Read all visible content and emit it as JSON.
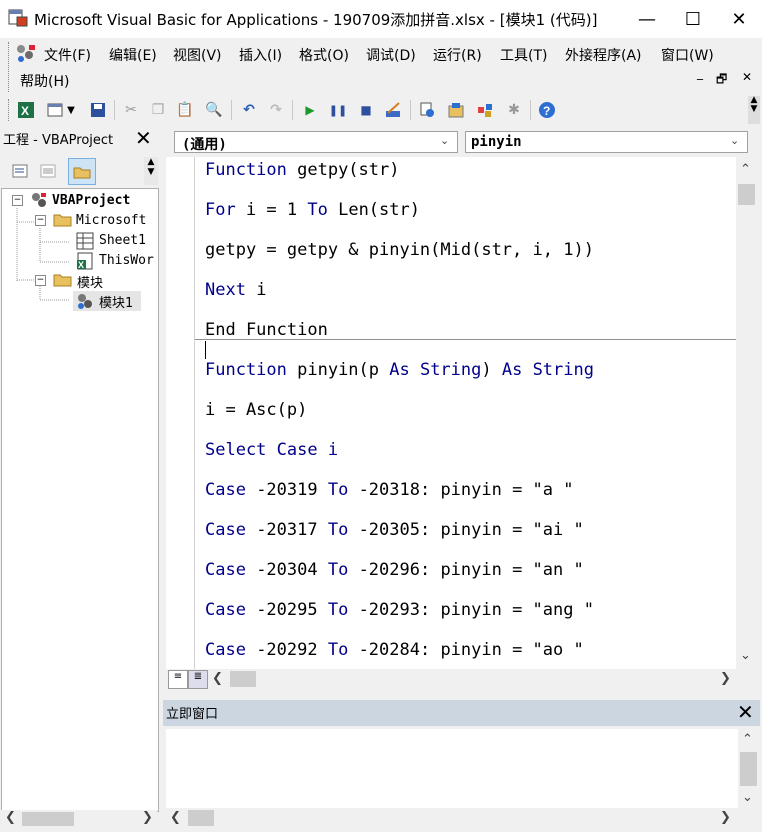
{
  "window": {
    "title": "Microsoft Visual Basic for Applications - 190709添加拼音.xlsx - [模块1 (代码)]",
    "minimize": "—",
    "maximize": "☐",
    "close": "✕"
  },
  "menu": {
    "items": [
      "文件(F)",
      "编辑(E)",
      "视图(V)",
      "插入(I)",
      "格式(O)",
      "调试(D)",
      "运行(R)",
      "工具(T)",
      "外接程序(A)",
      "窗口(W)",
      "帮助(H)"
    ],
    "mdi_min": "_",
    "mdi_restore": "🗗",
    "mdi_close": "✕"
  },
  "toolbar": {
    "icons": [
      "excel-icon",
      "insert-module-icon",
      "save-icon",
      "cut-icon",
      "copy-icon",
      "paste-icon",
      "find-icon",
      "undo-icon",
      "redo-icon",
      "run-icon",
      "break-icon",
      "reset-icon",
      "design-mode-icon",
      "project-explorer-icon",
      "properties-icon",
      "object-browser-icon",
      "toolbox-icon",
      "help-icon"
    ]
  },
  "project": {
    "title": "工程 - VBAProject",
    "close": "✕",
    "tree": [
      {
        "label": "VBAProject",
        "level": 0
      },
      {
        "label": "Microsoft",
        "level": 1
      },
      {
        "label": "Sheet1",
        "level": 2
      },
      {
        "label": "ThisWor",
        "level": 2
      },
      {
        "label": "模块",
        "level": 1
      },
      {
        "label": "模块1",
        "level": 2
      }
    ]
  },
  "code": {
    "object_combo": "(通用)",
    "proc_combo": "pinyin",
    "lines": [
      "Function getpy(str)",
      "For i = 1 To Len(str)",
      "getpy = getpy & pinyin(Mid(str, i, 1))",
      "Next i",
      "End Function",
      "Function pinyin(p As String) As String",
      "i = Asc(p)",
      "Select Case i",
      "Case -20319 To -20318: pinyin = \"a \"",
      "Case -20317 To -20305: pinyin = \"ai \"",
      "Case -20304 To -20296: pinyin = \"an \"",
      "Case -20295 To -20293: pinyin = \"ang \"",
      "Case -20292 To -20284: pinyin = \"ao \""
    ],
    "keyword_color": "#00008b"
  },
  "immediate": {
    "title": "立即窗口",
    "close": "✕"
  },
  "colors": {
    "accent_title": "#ccd6e0",
    "keyword": "#00008b"
  }
}
